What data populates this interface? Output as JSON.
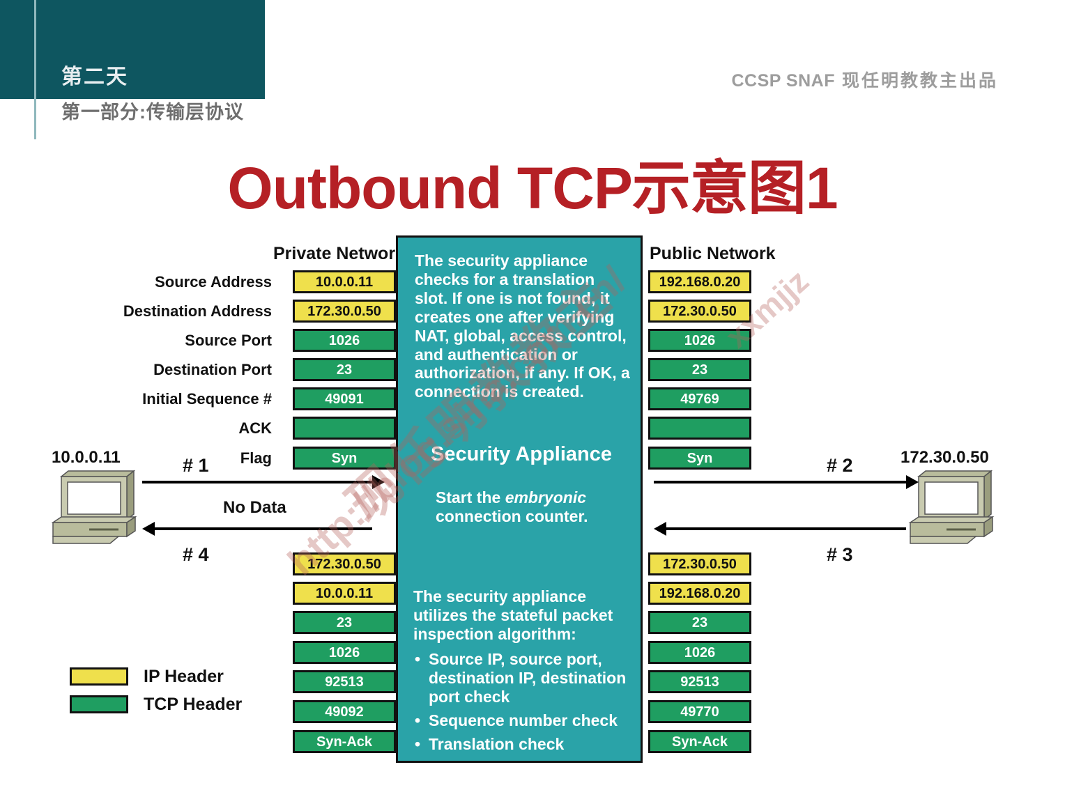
{
  "header": {
    "day": "第二天",
    "subtitle": "第一部分:传输层协议",
    "course": "CCSP SNAF",
    "author": "现任明教教主出品"
  },
  "title": "Outbound TCP示意图1",
  "columns": {
    "private_label": "Private Network",
    "public_label": "Public Network"
  },
  "row_labels": [
    "Source Address",
    "Destination Address",
    "Source Port",
    "Destination Port",
    "Initial Sequence #",
    "ACK",
    "Flag"
  ],
  "top_private": [
    {
      "value": "10.0.0.11",
      "kind": "ip"
    },
    {
      "value": "172.30.0.50",
      "kind": "ip"
    },
    {
      "value": "1026",
      "kind": "tcp"
    },
    {
      "value": "23",
      "kind": "tcp"
    },
    {
      "value": "49091",
      "kind": "tcp"
    },
    {
      "value": "",
      "kind": "tcp"
    },
    {
      "value": "Syn",
      "kind": "tcp"
    }
  ],
  "top_public": [
    {
      "value": "192.168.0.20",
      "kind": "ip"
    },
    {
      "value": "172.30.0.50",
      "kind": "ip"
    },
    {
      "value": "1026",
      "kind": "tcp"
    },
    {
      "value": "23",
      "kind": "tcp"
    },
    {
      "value": "49769",
      "kind": "tcp"
    },
    {
      "value": "",
      "kind": "tcp"
    },
    {
      "value": "Syn",
      "kind": "tcp"
    }
  ],
  "bottom_private": [
    {
      "value": "172.30.0.50",
      "kind": "ip"
    },
    {
      "value": "10.0.0.11",
      "kind": "ip"
    },
    {
      "value": "23",
      "kind": "tcp"
    },
    {
      "value": "1026",
      "kind": "tcp"
    },
    {
      "value": "92513",
      "kind": "tcp"
    },
    {
      "value": "49092",
      "kind": "tcp"
    },
    {
      "value": "Syn-Ack",
      "kind": "tcp"
    }
  ],
  "bottom_public": [
    {
      "value": "172.30.0.50",
      "kind": "ip"
    },
    {
      "value": "192.168.0.20",
      "kind": "ip"
    },
    {
      "value": "23",
      "kind": "tcp"
    },
    {
      "value": "1026",
      "kind": "tcp"
    },
    {
      "value": "92513",
      "kind": "tcp"
    },
    {
      "value": "49770",
      "kind": "tcp"
    },
    {
      "value": "Syn-Ack",
      "kind": "tcp"
    }
  ],
  "appliance": {
    "paragraph1": "The security appliance checks for a translation slot. If one is not found,  it creates one after verifying NAT, global, access control, and authentication or authorization, if any. If OK, a connection is created.",
    "title": "Security  Appliance",
    "paragraph2_pre": "Start the ",
    "paragraph2_em": "embryonic",
    "paragraph2_post": " connection counter.",
    "paragraph3": "The security appliance utilizes the stateful packet inspection algorithm:",
    "bullets": [
      "Source IP, source port, destination IP, destination port check",
      "Sequence number check",
      "Translation check"
    ]
  },
  "hosts": {
    "left_ip": "10.0.0.11",
    "right_ip": "172.30.0.50"
  },
  "arrows": {
    "step1": "# 1",
    "step2": "# 2",
    "step3": "# 3",
    "step4": "# 4",
    "no_data": "No Data"
  },
  "legend": [
    {
      "label": "IP Header",
      "kind": "ip"
    },
    {
      "label": "TCP Header",
      "kind": "tcp"
    }
  ],
  "watermark": {
    "url": "http://blog.sina.com.cn/",
    "handle": "xxmjjz",
    "cn": "现任明教教主"
  },
  "colors": {
    "header_band": "#0e5660",
    "title_red": "#b52025",
    "ip_yellow": "#efe04c",
    "tcp_green": "#1f9e61",
    "appliance_teal": "#2aa3a8"
  }
}
